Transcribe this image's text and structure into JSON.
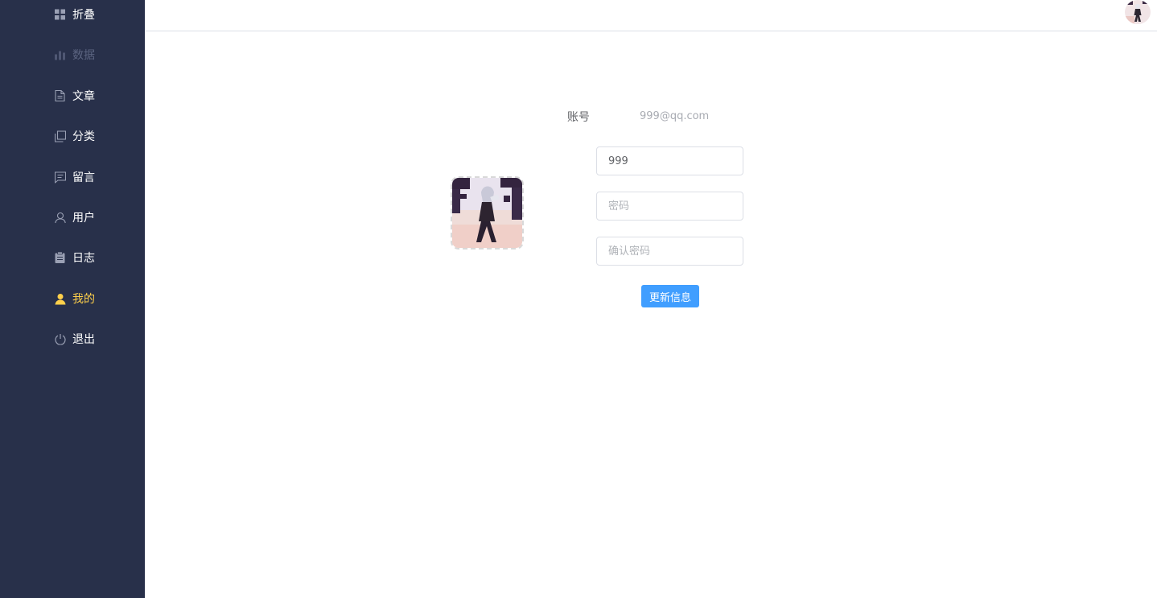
{
  "sidebar": {
    "items": [
      {
        "label": "折叠",
        "icon": "grid-icon"
      },
      {
        "label": "数据",
        "icon": "bar-chart-icon"
      },
      {
        "label": "文章",
        "icon": "document-icon"
      },
      {
        "label": "分类",
        "icon": "copy-icon"
      },
      {
        "label": "留言",
        "icon": "chat-icon"
      },
      {
        "label": "用户",
        "icon": "user-icon"
      },
      {
        "label": "日志",
        "icon": "clipboard-icon"
      },
      {
        "label": "我的",
        "icon": "user-filled-icon"
      },
      {
        "label": "退出",
        "icon": "power-icon"
      }
    ],
    "bg_color": "#28304a",
    "active_color": "#ffd04b"
  },
  "profile": {
    "account_label": "账号",
    "account_value": "999@qq.com",
    "username_value": "999",
    "password_placeholder": "密码",
    "confirm_placeholder": "确认密码",
    "submit_label": "更新信息",
    "button_color": "#409eff"
  }
}
